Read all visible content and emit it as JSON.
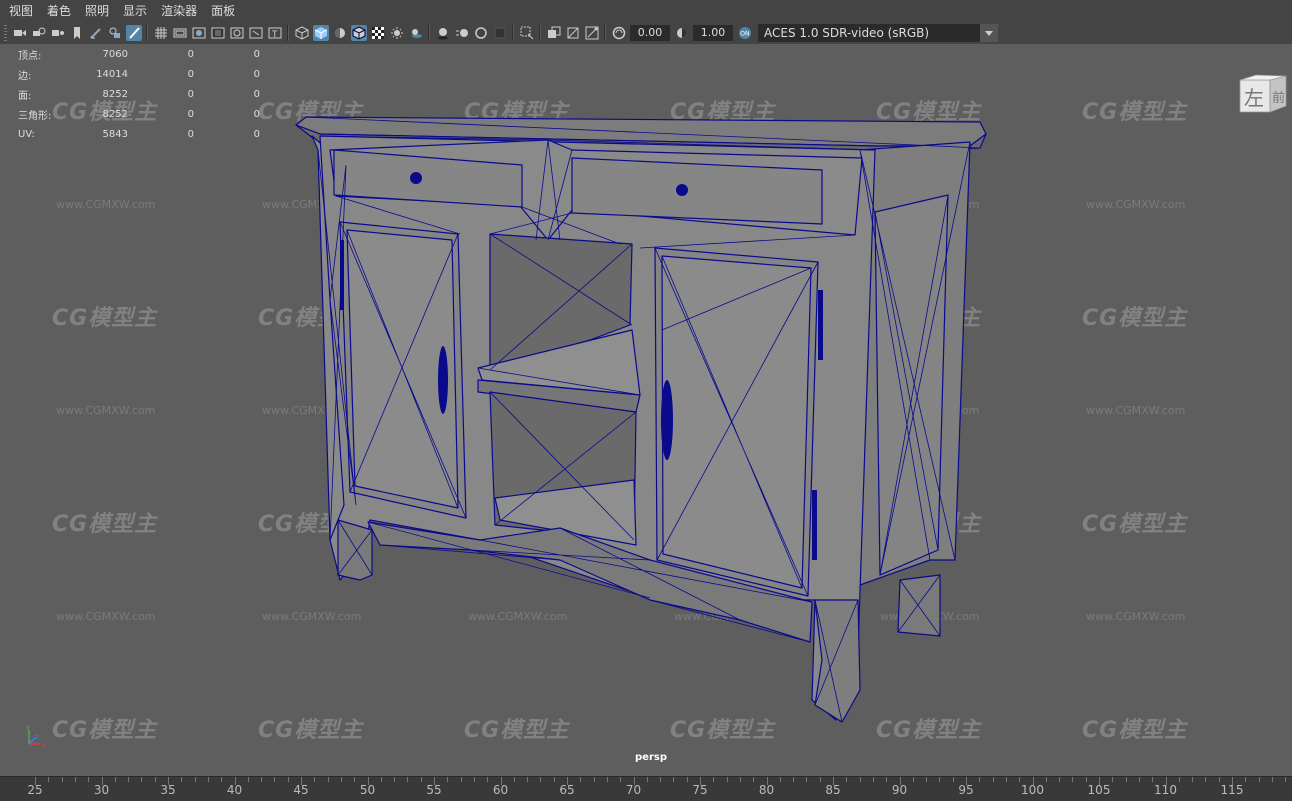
{
  "menubar": [
    "视图",
    "着色",
    "照明",
    "显示",
    "渲染器",
    "面板"
  ],
  "toolbar": {
    "exposure_value": "0.00",
    "gamma_value": "1.00",
    "colorspace_label": "ACES 1.0 SDR-video (sRGB)",
    "colorspace_toggle": "ON"
  },
  "hud": [
    {
      "label": "顶点:",
      "v1": "7060",
      "v2": "0",
      "v3": "0"
    },
    {
      "label": "边:",
      "v1": "14014",
      "v2": "0",
      "v3": "0"
    },
    {
      "label": "面:",
      "v1": "8252",
      "v2": "0",
      "v3": "0"
    },
    {
      "label": "三角形:",
      "v1": "8252",
      "v2": "0",
      "v3": "0"
    },
    {
      "label": "UV:",
      "v1": "5843",
      "v2": "0",
      "v3": "0"
    }
  ],
  "viewcube": {
    "left_face": "左",
    "front_face": "前"
  },
  "camera_name": "persp",
  "axis_labels": {
    "y": "y",
    "x": "x",
    "z": "z"
  },
  "watermark": {
    "logo": "CG模型主",
    "url": "www.CGMXW.com"
  },
  "timeslider": {
    "ticks": [
      "25",
      "30",
      "35",
      "40",
      "45",
      "50",
      "55",
      "60",
      "65",
      "70",
      "75",
      "80",
      "85",
      "90",
      "95",
      "100",
      "105",
      "110",
      "115"
    ]
  },
  "colors": {
    "wireframe": "#0a0a8c",
    "viewport_bg": "#5e5e5e",
    "active_icon": "#5285a6"
  }
}
